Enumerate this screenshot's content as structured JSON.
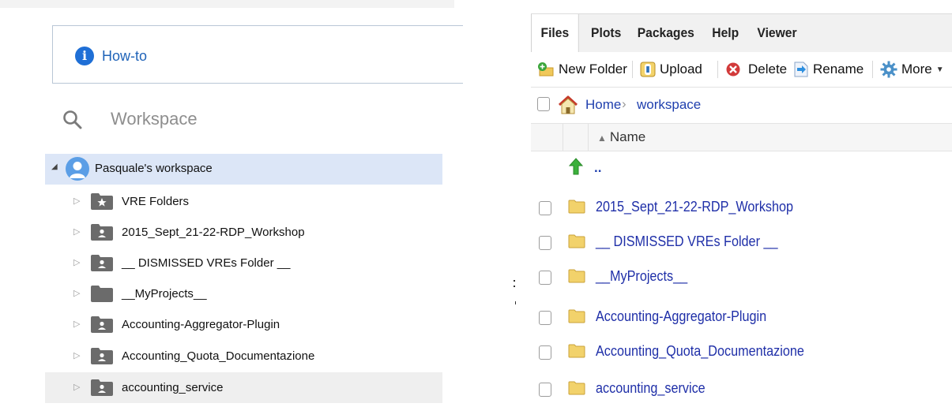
{
  "left_panel": {
    "howto_label": "How-to",
    "search_placeholder": "Workspace",
    "root": {
      "label": "Pasquale's workspace"
    },
    "items": [
      {
        "label": "VRE Folders",
        "icon": "star-folder-icon"
      },
      {
        "label": "2015_Sept_21-22-RDP_Workshop",
        "icon": "shared-folder-icon"
      },
      {
        "label": "__ DISMISSED VREs Folder __",
        "icon": "shared-folder-icon"
      },
      {
        "label": "__MyProjects__",
        "icon": "folder-icon"
      },
      {
        "label": "Accounting-Aggregator-Plugin",
        "icon": "shared-folder-icon"
      },
      {
        "label": "Accounting_Quota_Documentazione",
        "icon": "shared-folder-icon"
      },
      {
        "label": "accounting_service",
        "icon": "shared-folder-icon"
      }
    ]
  },
  "right_panel": {
    "tabs": [
      "Files",
      "Plots",
      "Packages",
      "Help",
      "Viewer"
    ],
    "active_tab": "Files",
    "toolbar": {
      "new_folder": "New Folder",
      "upload": "Upload",
      "delete": "Delete",
      "rename": "Rename",
      "more": "More"
    },
    "breadcrumb": {
      "home": "Home",
      "separator": "›",
      "current": "workspace"
    },
    "column_header": "Name",
    "up_label": "..",
    "files": [
      "2015_Sept_21-22-RDP_Workshop",
      "__ DISMISSED VREs Folder __",
      "__MyProjects__",
      "Accounting-Aggregator-Plugin",
      "Accounting_Quota_Documentazione",
      "accounting_service"
    ]
  },
  "colors": {
    "link": "#1f2fa8",
    "selection": "#dce6f7",
    "info_blue": "#1f6fd6",
    "folder_gray": "#6b6b6b",
    "folder_yellow": "#f2d26b"
  }
}
